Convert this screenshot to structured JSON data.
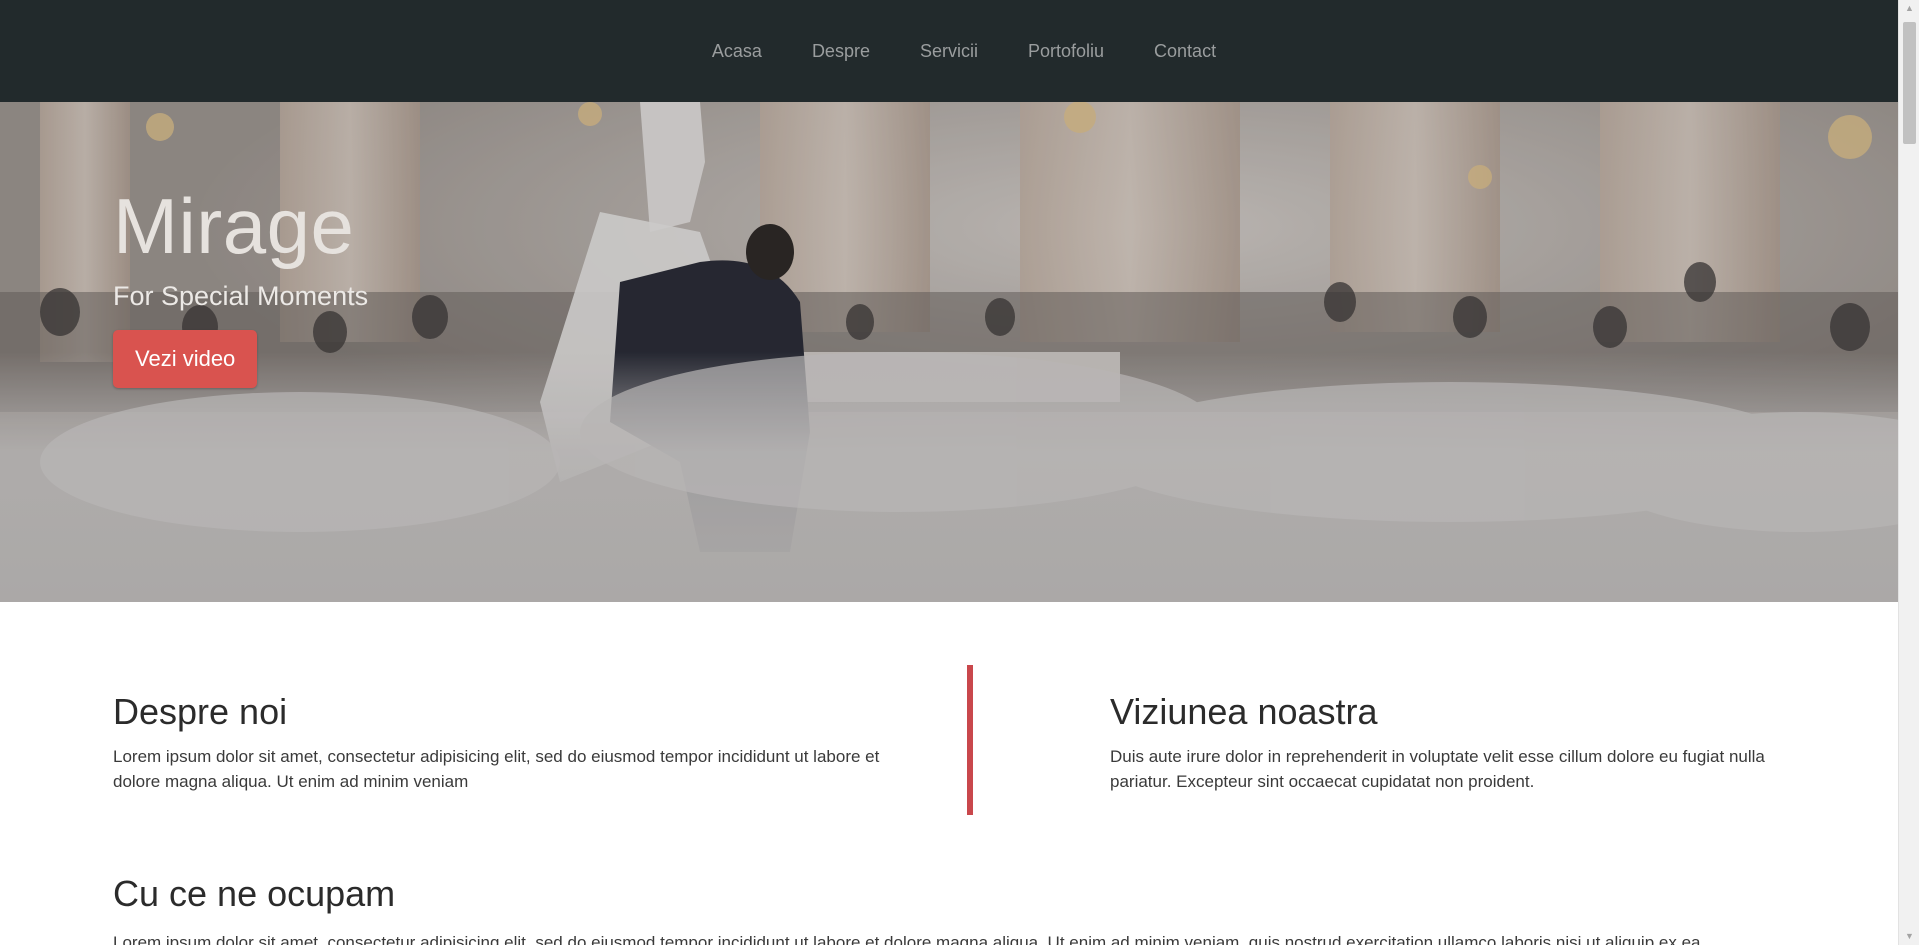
{
  "nav": {
    "items": [
      {
        "label": "Acasa"
      },
      {
        "label": "Despre"
      },
      {
        "label": "Servicii"
      },
      {
        "label": "Portofoliu"
      },
      {
        "label": "Contact"
      }
    ]
  },
  "hero": {
    "title": "Mirage",
    "subtitle": "For Special Moments",
    "button_label": "Vezi video",
    "image_icon": "wedding-dance-photo"
  },
  "about": {
    "left": {
      "heading": "Despre noi",
      "text": "Lorem ipsum dolor sit amet, consectetur adipisicing elit, sed do eiusmod tempor incididunt ut labore et dolore magna aliqua. Ut enim ad minim veniam"
    },
    "right": {
      "heading": "Viziunea noastra",
      "text": "Duis aute irure dolor in reprehenderit in voluptate velit esse cillum dolore eu fugiat nulla pariatur. Excepteur sint occaecat cupidatat non proident."
    },
    "divider_color": "#c9474c"
  },
  "services": {
    "heading": "Cu ce ne ocupam",
    "text": "Lorem ipsum dolor sit amet, consectetur adipisicing elit, sed do eiusmod tempor incididunt ut labore et dolore magna aliqua. Ut enim ad minim veniam, quis nostrud exercitation ullamco laboris nisi ut aliquip ex ea"
  },
  "colors": {
    "navbar": "#222a2c",
    "accent": "#d9534f"
  }
}
